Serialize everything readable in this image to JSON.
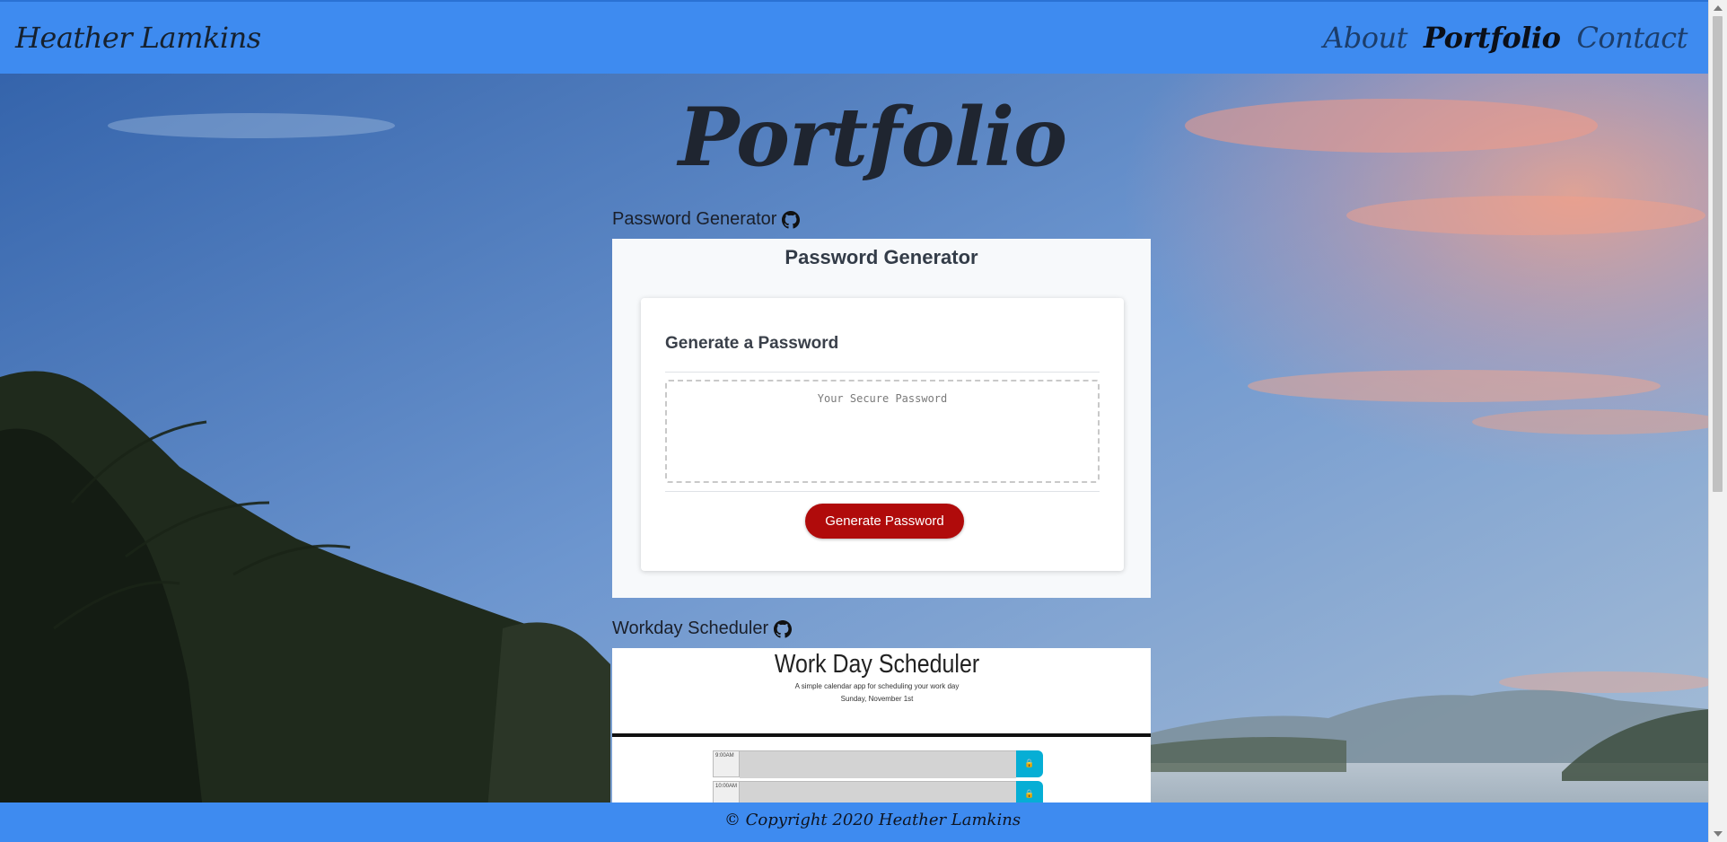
{
  "colors": {
    "navbar": "#3e8bf0",
    "footer": "#3e8bf0",
    "generate_button": "#b00b0b",
    "scheduler_save": "#06aed5"
  },
  "navbar": {
    "brand": "Heather Lamkins",
    "links": [
      {
        "label": "About",
        "active": false
      },
      {
        "label": "Portfolio",
        "active": true
      },
      {
        "label": "Contact",
        "active": false
      }
    ]
  },
  "page": {
    "title": "Portfolio"
  },
  "projects": [
    {
      "name": "Password Generator",
      "icon": "github-icon",
      "screenshot": {
        "heading": "Password Generator",
        "card_title": "Generate a Password",
        "textarea_placeholder": "Your Secure Password",
        "button_label": "Generate Password"
      }
    },
    {
      "name": "Workday Scheduler",
      "icon": "github-icon",
      "screenshot": {
        "heading": "Work Day Scheduler",
        "subtitle": "A simple calendar app for scheduling your work day",
        "date": "Sunday, November 1st",
        "hours": [
          "9:00AM",
          "10:00AM"
        ],
        "save_icon": "lock-icon"
      }
    }
  ],
  "footer": {
    "text": "© Copyright 2020 Heather Lamkins"
  }
}
